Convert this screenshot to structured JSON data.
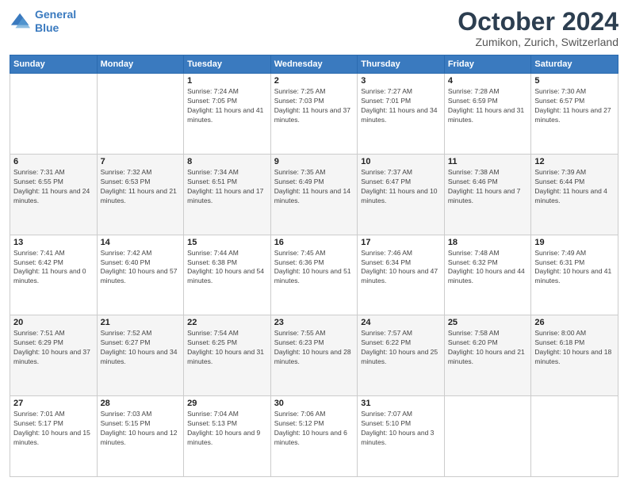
{
  "header": {
    "logo_line1": "General",
    "logo_line2": "Blue",
    "title": "October 2024",
    "subtitle": "Zumikon, Zurich, Switzerland"
  },
  "weekdays": [
    "Sunday",
    "Monday",
    "Tuesday",
    "Wednesday",
    "Thursday",
    "Friday",
    "Saturday"
  ],
  "weeks": [
    [
      {
        "day": "",
        "sunrise": "",
        "sunset": "",
        "daylight": ""
      },
      {
        "day": "",
        "sunrise": "",
        "sunset": "",
        "daylight": ""
      },
      {
        "day": "1",
        "sunrise": "Sunrise: 7:24 AM",
        "sunset": "Sunset: 7:05 PM",
        "daylight": "Daylight: 11 hours and 41 minutes."
      },
      {
        "day": "2",
        "sunrise": "Sunrise: 7:25 AM",
        "sunset": "Sunset: 7:03 PM",
        "daylight": "Daylight: 11 hours and 37 minutes."
      },
      {
        "day": "3",
        "sunrise": "Sunrise: 7:27 AM",
        "sunset": "Sunset: 7:01 PM",
        "daylight": "Daylight: 11 hours and 34 minutes."
      },
      {
        "day": "4",
        "sunrise": "Sunrise: 7:28 AM",
        "sunset": "Sunset: 6:59 PM",
        "daylight": "Daylight: 11 hours and 31 minutes."
      },
      {
        "day": "5",
        "sunrise": "Sunrise: 7:30 AM",
        "sunset": "Sunset: 6:57 PM",
        "daylight": "Daylight: 11 hours and 27 minutes."
      }
    ],
    [
      {
        "day": "6",
        "sunrise": "Sunrise: 7:31 AM",
        "sunset": "Sunset: 6:55 PM",
        "daylight": "Daylight: 11 hours and 24 minutes."
      },
      {
        "day": "7",
        "sunrise": "Sunrise: 7:32 AM",
        "sunset": "Sunset: 6:53 PM",
        "daylight": "Daylight: 11 hours and 21 minutes."
      },
      {
        "day": "8",
        "sunrise": "Sunrise: 7:34 AM",
        "sunset": "Sunset: 6:51 PM",
        "daylight": "Daylight: 11 hours and 17 minutes."
      },
      {
        "day": "9",
        "sunrise": "Sunrise: 7:35 AM",
        "sunset": "Sunset: 6:49 PM",
        "daylight": "Daylight: 11 hours and 14 minutes."
      },
      {
        "day": "10",
        "sunrise": "Sunrise: 7:37 AM",
        "sunset": "Sunset: 6:47 PM",
        "daylight": "Daylight: 11 hours and 10 minutes."
      },
      {
        "day": "11",
        "sunrise": "Sunrise: 7:38 AM",
        "sunset": "Sunset: 6:46 PM",
        "daylight": "Daylight: 11 hours and 7 minutes."
      },
      {
        "day": "12",
        "sunrise": "Sunrise: 7:39 AM",
        "sunset": "Sunset: 6:44 PM",
        "daylight": "Daylight: 11 hours and 4 minutes."
      }
    ],
    [
      {
        "day": "13",
        "sunrise": "Sunrise: 7:41 AM",
        "sunset": "Sunset: 6:42 PM",
        "daylight": "Daylight: 11 hours and 0 minutes."
      },
      {
        "day": "14",
        "sunrise": "Sunrise: 7:42 AM",
        "sunset": "Sunset: 6:40 PM",
        "daylight": "Daylight: 10 hours and 57 minutes."
      },
      {
        "day": "15",
        "sunrise": "Sunrise: 7:44 AM",
        "sunset": "Sunset: 6:38 PM",
        "daylight": "Daylight: 10 hours and 54 minutes."
      },
      {
        "day": "16",
        "sunrise": "Sunrise: 7:45 AM",
        "sunset": "Sunset: 6:36 PM",
        "daylight": "Daylight: 10 hours and 51 minutes."
      },
      {
        "day": "17",
        "sunrise": "Sunrise: 7:46 AM",
        "sunset": "Sunset: 6:34 PM",
        "daylight": "Daylight: 10 hours and 47 minutes."
      },
      {
        "day": "18",
        "sunrise": "Sunrise: 7:48 AM",
        "sunset": "Sunset: 6:32 PM",
        "daylight": "Daylight: 10 hours and 44 minutes."
      },
      {
        "day": "19",
        "sunrise": "Sunrise: 7:49 AM",
        "sunset": "Sunset: 6:31 PM",
        "daylight": "Daylight: 10 hours and 41 minutes."
      }
    ],
    [
      {
        "day": "20",
        "sunrise": "Sunrise: 7:51 AM",
        "sunset": "Sunset: 6:29 PM",
        "daylight": "Daylight: 10 hours and 37 minutes."
      },
      {
        "day": "21",
        "sunrise": "Sunrise: 7:52 AM",
        "sunset": "Sunset: 6:27 PM",
        "daylight": "Daylight: 10 hours and 34 minutes."
      },
      {
        "day": "22",
        "sunrise": "Sunrise: 7:54 AM",
        "sunset": "Sunset: 6:25 PM",
        "daylight": "Daylight: 10 hours and 31 minutes."
      },
      {
        "day": "23",
        "sunrise": "Sunrise: 7:55 AM",
        "sunset": "Sunset: 6:23 PM",
        "daylight": "Daylight: 10 hours and 28 minutes."
      },
      {
        "day": "24",
        "sunrise": "Sunrise: 7:57 AM",
        "sunset": "Sunset: 6:22 PM",
        "daylight": "Daylight: 10 hours and 25 minutes."
      },
      {
        "day": "25",
        "sunrise": "Sunrise: 7:58 AM",
        "sunset": "Sunset: 6:20 PM",
        "daylight": "Daylight: 10 hours and 21 minutes."
      },
      {
        "day": "26",
        "sunrise": "Sunrise: 8:00 AM",
        "sunset": "Sunset: 6:18 PM",
        "daylight": "Daylight: 10 hours and 18 minutes."
      }
    ],
    [
      {
        "day": "27",
        "sunrise": "Sunrise: 7:01 AM",
        "sunset": "Sunset: 5:17 PM",
        "daylight": "Daylight: 10 hours and 15 minutes."
      },
      {
        "day": "28",
        "sunrise": "Sunrise: 7:03 AM",
        "sunset": "Sunset: 5:15 PM",
        "daylight": "Daylight: 10 hours and 12 minutes."
      },
      {
        "day": "29",
        "sunrise": "Sunrise: 7:04 AM",
        "sunset": "Sunset: 5:13 PM",
        "daylight": "Daylight: 10 hours and 9 minutes."
      },
      {
        "day": "30",
        "sunrise": "Sunrise: 7:06 AM",
        "sunset": "Sunset: 5:12 PM",
        "daylight": "Daylight: 10 hours and 6 minutes."
      },
      {
        "day": "31",
        "sunrise": "Sunrise: 7:07 AM",
        "sunset": "Sunset: 5:10 PM",
        "daylight": "Daylight: 10 hours and 3 minutes."
      },
      {
        "day": "",
        "sunrise": "",
        "sunset": "",
        "daylight": ""
      },
      {
        "day": "",
        "sunrise": "",
        "sunset": "",
        "daylight": ""
      }
    ]
  ]
}
